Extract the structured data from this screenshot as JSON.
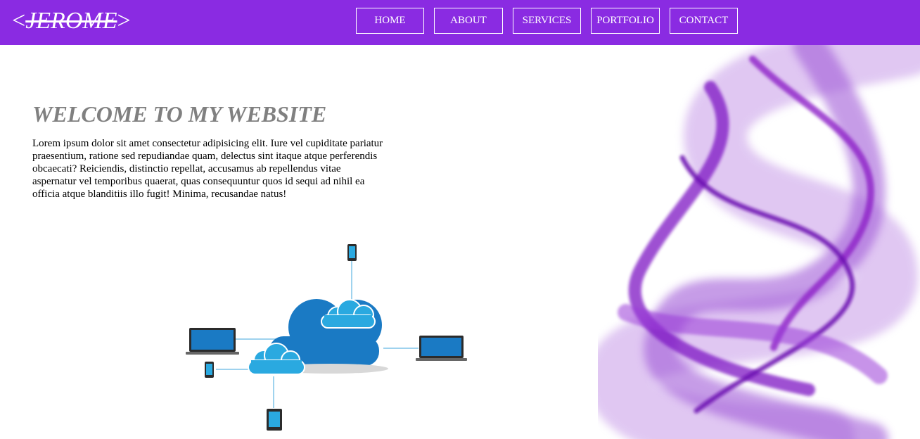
{
  "header": {
    "logo_left": "<",
    "logo_name": "JEROME",
    "logo_right": ">",
    "nav": [
      {
        "label": "HOME"
      },
      {
        "label": "ABOUT"
      },
      {
        "label": "SERVICES"
      },
      {
        "label": "PORTFOLIO"
      },
      {
        "label": "CONTACT"
      }
    ]
  },
  "main": {
    "title": "WELCOME TO MY WEBSITE",
    "body": "Lorem ipsum dolor sit amet consectetur adipisicing elit. Iure vel cupiditate pariatur praesentium, ratione sed repudiandae quam, delectus sint itaque atque perferendis obcaecati? Reiciendis, distinctio repellat, accusamus ab repellendus vitae aspernatur vel temporibus quaerat, quas consequuntur quos id sequi ad nihil ea officia atque blanditiis illo fugit! Minima, recusandae natus!"
  },
  "colors": {
    "navbar": "#8a2be2",
    "heading": "#808080",
    "cloud_dark": "#1a7ac4",
    "cloud_light": "#2aa9e0",
    "smoke": "#8e24c8"
  },
  "images": {
    "illustration": "cloud-network-illustration",
    "decor": "purple-smoke-image"
  }
}
